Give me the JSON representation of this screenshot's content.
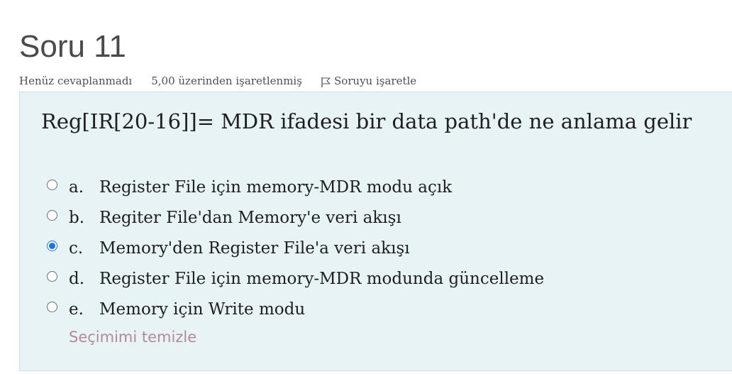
{
  "question": {
    "title": "Soru 11",
    "status": "Henüz cevaplanmadı",
    "grade": "5,00 üzerinden işaretlenmiş",
    "flag_label": "Soruyu işaretle",
    "prompt": "Reg[IR[20-16]]= MDR ifadesi bir data path'de ne anlama gelir",
    "answers": [
      {
        "letter": "a.",
        "text": "Register File için memory-MDR modu açık",
        "selected": false
      },
      {
        "letter": "b.",
        "text": "Regiter File'dan Memory'e veri akışı",
        "selected": false
      },
      {
        "letter": "c.",
        "text": "Memory'den Register File'a veri akışı",
        "selected": true
      },
      {
        "letter": "d.",
        "text": "Register File için memory-MDR modunda güncelleme",
        "selected": false
      },
      {
        "letter": "e.",
        "text": "Memory için Write modu",
        "selected": false
      }
    ],
    "clear_label": "Seçimimi temizle"
  },
  "icons": {
    "flag": "flag-icon"
  },
  "colors": {
    "question_background": "#e7f3f5",
    "selected_radio": "#1a73e8",
    "clear_link": "#b58a98"
  }
}
